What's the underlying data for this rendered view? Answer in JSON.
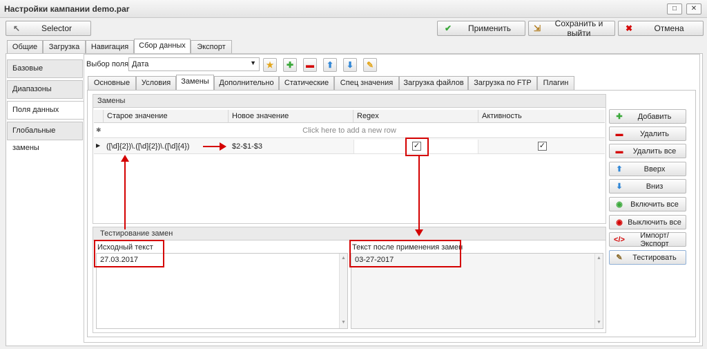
{
  "window": {
    "title": "Настройки кампании demo.par",
    "minimize": "□",
    "close": "✕"
  },
  "toolbar": {
    "selector_label": "Selector",
    "apply_label": "Применить",
    "save_exit_label": "Сохранить и выйти",
    "cancel_label": "Отмена"
  },
  "main_tabs": [
    "Общие",
    "Загрузка",
    "Навигация",
    "Сбор данных",
    "Экспорт"
  ],
  "sidebar": {
    "items": [
      "Базовые",
      "Диапазоны",
      "Поля данных",
      "Глобальные замены"
    ]
  },
  "field_select": {
    "label": "Выбор поля",
    "value": "Дата"
  },
  "sub_tabs": [
    "Основные",
    "Условия",
    "Замены",
    "Дополнительно",
    "Статические",
    "Спец значения",
    "Загрузка файлов",
    "Загрузка по FTP",
    "Плагин"
  ],
  "replacements": {
    "group_title": "Замены",
    "columns": [
      "Старое значение",
      "Новое значение",
      "Regex",
      "Активность"
    ],
    "new_row_hint": "Click here to add a new row",
    "rows": [
      {
        "old": "([\\d]{2})\\.([\\d]{2})\\.([\\d]{4})",
        "new": "$2-$1-$3",
        "regex": true,
        "active": true
      }
    ]
  },
  "side_buttons": [
    "Добавить",
    "Удалить",
    "Удалить все",
    "Вверх",
    "Вниз",
    "Включить все",
    "Выключить все",
    "Импорт/Экспорт",
    "Тестировать"
  ],
  "testing": {
    "group_title": "Тестирование замен",
    "source_label": "Исходный текст",
    "source_value": "27.03.2017",
    "result_label": "Текст после применения замен",
    "result_value": "03-27-2017"
  },
  "colors": {
    "accent_red": "#d40000",
    "green": "#3aa83a",
    "blue": "#2f86d6"
  }
}
